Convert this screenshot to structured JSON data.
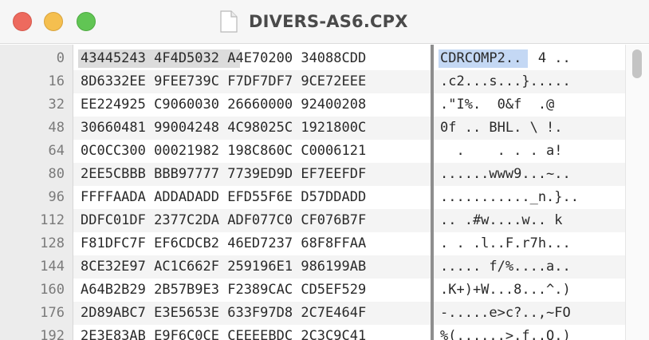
{
  "window": {
    "title": "DIVERS-AS6.CPX",
    "icon": "document-icon"
  },
  "hex_view": {
    "rows": [
      {
        "offset": "0",
        "hex": "43445243 4F4D5032 A4E70200 34088CDD",
        "ascii": "CDRCOMP2..  4 .."
      },
      {
        "offset": "16",
        "hex": "8D6332EE 9FEE739C F7DF7DF7 9CE72EEE",
        "ascii": ".c2...s...}....."
      },
      {
        "offset": "32",
        "hex": "EE224925 C9060030 26660000 92400208",
        "ascii": ".\"I%.  0&f  .@  "
      },
      {
        "offset": "48",
        "hex": "30660481 99004248 4C98025C 1921800C",
        "ascii": "0f .. BHL. \\ !. "
      },
      {
        "offset": "64",
        "hex": "0C0CC300 00021982 198C860C C0006121",
        "ascii": "  .    . . . a!"
      },
      {
        "offset": "80",
        "hex": "2EE5CBBB BBB97777 7739ED9D EF7EEFDF",
        "ascii": "......www9...~.."
      },
      {
        "offset": "96",
        "hex": "FFFFAADA ADDADADD EFD55F6E D57DDADD",
        "ascii": "..........._n.}.."
      },
      {
        "offset": "112",
        "hex": "DDFC01DF 2377C2DA ADF077C0 CF076B7F",
        "ascii": ".. .#w....w.. k"
      },
      {
        "offset": "128",
        "hex": "F81DFC7F EF6CDCB2 46ED7237 68F8FFAA",
        "ascii": ". . .l..F.r7h..."
      },
      {
        "offset": "144",
        "hex": "8CE32E97 AC1C662F 259196E1 986199AB",
        "ascii": "..... f/%....a.."
      },
      {
        "offset": "160",
        "hex": "A64B2B29 2B57B9E3 F2389CAC CD5EF529",
        "ascii": ".K+)+W...8...^.)"
      },
      {
        "offset": "176",
        "hex": "2D89ABC7 E3E5653E 633F97D8 2C7E464F",
        "ascii": "-.....e>c?..,~FO"
      },
      {
        "offset": "192",
        "hex": "2E3E83AB E9F6C0CE CEEEEBDC 2C3C9C41",
        "ascii": "%(......>.f..Q.)"
      }
    ]
  },
  "colors": {
    "selection_hex": "#dcdcdc",
    "selection_ascii": "#c4d8f4"
  }
}
